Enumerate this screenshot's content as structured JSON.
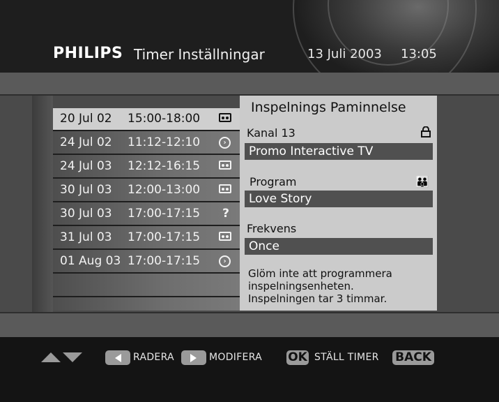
{
  "header": {
    "brand": "PHILIPS",
    "title": "Timer Inställningar",
    "date": "13 Juli 2003",
    "time": "13:05"
  },
  "timers": [
    {
      "date": "20 Jul 02",
      "time": "15:00-18:00",
      "icon": "vcr-icon",
      "selected": true
    },
    {
      "date": "24 Jul 02",
      "time": "11:12-12:10",
      "icon": "reminder-icon"
    },
    {
      "date": "24 Jul 03",
      "time": "12:12-16:15",
      "icon": "vcr-icon"
    },
    {
      "date": "30 Jul 03",
      "time": "12:00-13:00",
      "icon": "vcr-icon"
    },
    {
      "date": "30 Jul 03",
      "time": "17:00-17:15",
      "icon": "question-icon",
      "glyph": "?"
    },
    {
      "date": "31 Jul 03",
      "time": "17:00-17:15",
      "icon": "vcr-icon"
    },
    {
      "date": "01 Aug 03",
      "time": "17:00-17:15",
      "icon": "reminder-icon"
    }
  ],
  "detail": {
    "title": "Inspelnings Paminnelse",
    "channel_label": "Kanal 13",
    "channel_value": "Promo Interactive TV",
    "program_label": "Program",
    "program_value": "Love Story",
    "frequency_label": "Frekvens",
    "frequency_value": "Once",
    "note_line1": "Glöm inte att programmera",
    "note_line2": "inspelningsenheten.",
    "note_line3": "Inspelningen tar 3 timmar."
  },
  "footer": {
    "delete_label": "RADERA",
    "modify_label": "MODIFERA",
    "ok_key": "OK",
    "set_timer_label": "STÄLL TIMER",
    "back_key": "BACK"
  },
  "colors": {
    "selected_row": "#cfcfcf",
    "detail_panel": "#cbcbcb",
    "value_field": "#505050"
  }
}
